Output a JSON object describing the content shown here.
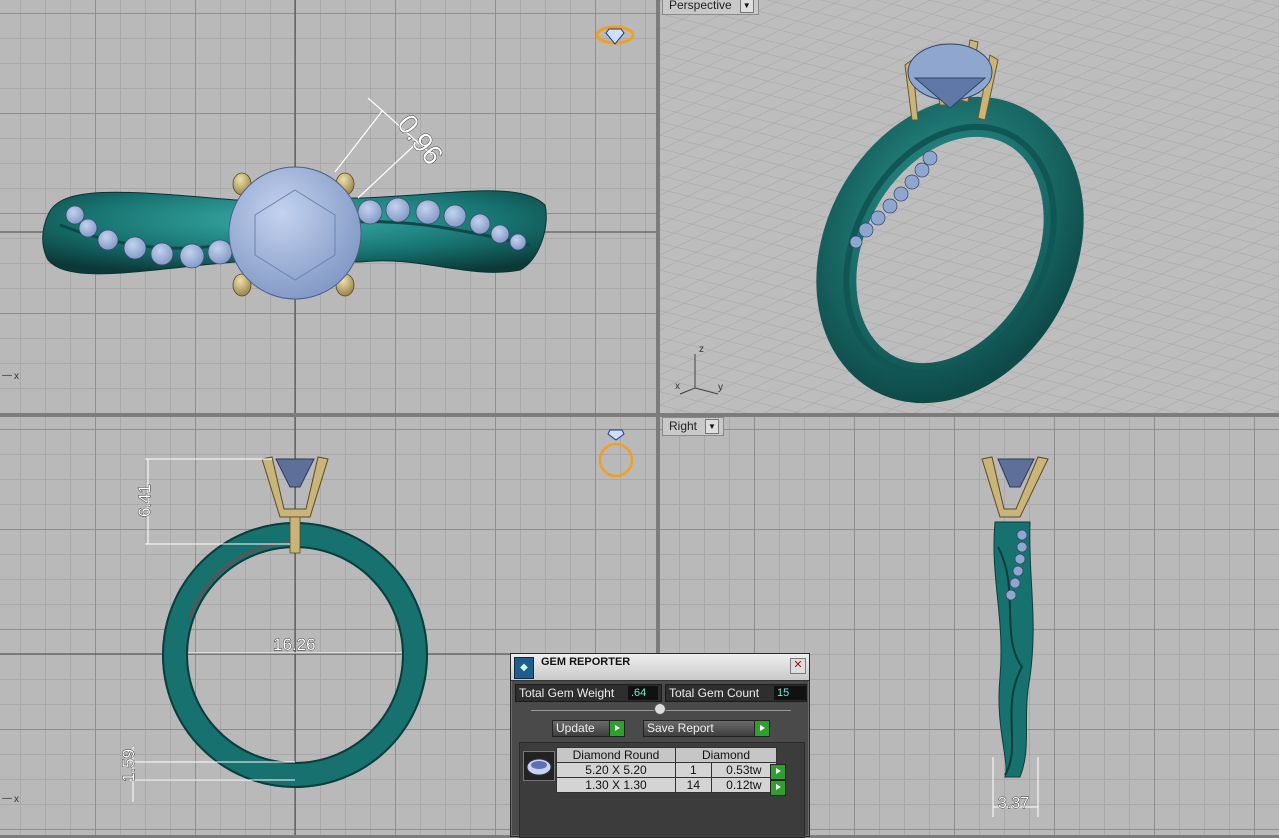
{
  "viewports": {
    "top": {
      "dimension": "0.96"
    },
    "perspective": {
      "label": "Perspective",
      "axis_z": "z",
      "axis_x": "x",
      "axis_y": "y"
    },
    "front": {
      "dim_height": "6.41",
      "dim_inner": "16.26",
      "dim_band": "1.59",
      "axis_x": "x"
    },
    "right": {
      "label": "Right",
      "dim_width": "3.37"
    }
  },
  "top_axis_x": "x",
  "gem_reporter": {
    "title": "GEM REPORTER",
    "total_weight_label": "Total Gem Weight",
    "total_weight_value": ".64",
    "total_count_label": "Total Gem Count",
    "total_count_value": "15",
    "update_label": "Update",
    "save_label": "Save Report",
    "table": {
      "headers": [
        "Diamond Round",
        "Diamond"
      ],
      "rows": [
        {
          "size": "5.20 X 5.20",
          "count": "1",
          "weight": "0.53tw"
        },
        {
          "size": "1.30 X 1.30",
          "count": "14",
          "weight": "0.12tw"
        }
      ]
    }
  },
  "colors": {
    "band": "#1e7f7d",
    "prongs": "#c9b47a",
    "gem": "#8fa6cf",
    "accent": "#f0a020"
  },
  "icons": [
    "ring-gem-gizmo-icon",
    "gem-reporter-logo-icon",
    "close-icon",
    "dropdown-arrow-icon",
    "go-arrow-icon"
  ]
}
